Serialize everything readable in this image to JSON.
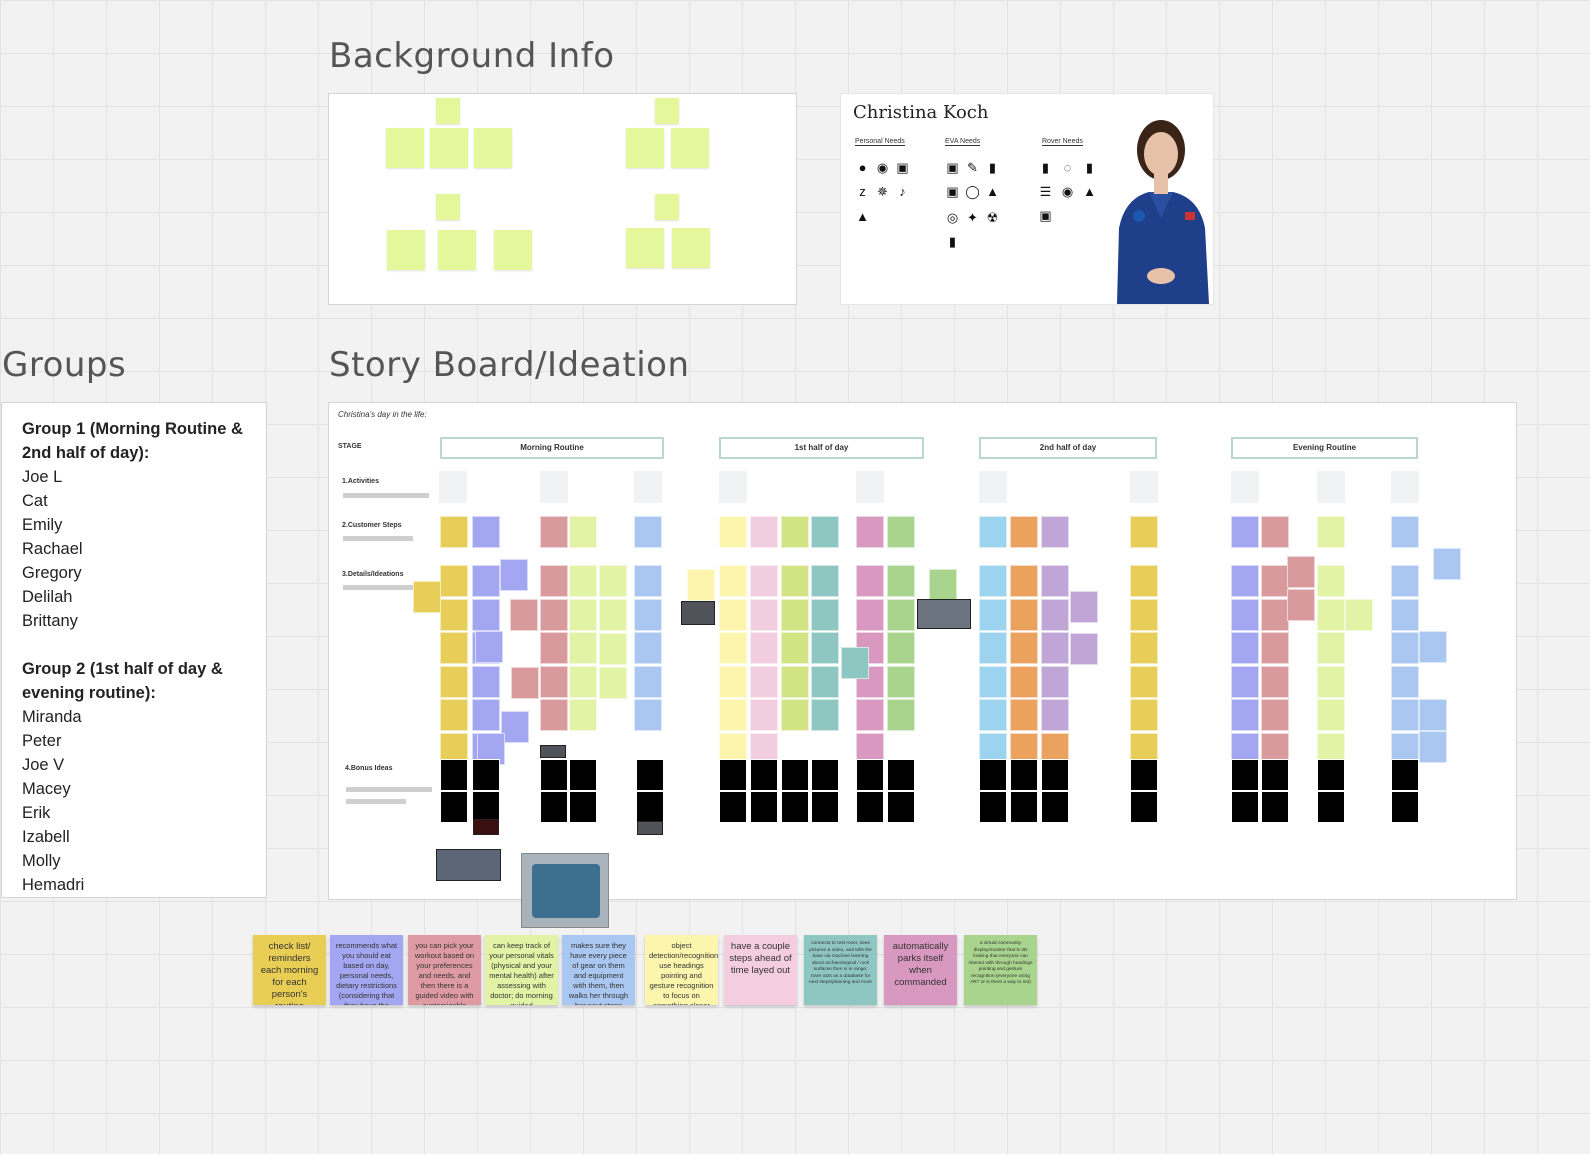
{
  "titles": {
    "background": "Background Info",
    "groups": "Groups",
    "storyboard": "Story Board/Ideation"
  },
  "persona": {
    "name": "Christina Koch",
    "col1": "Personal Needs",
    "col2": "EVA Needs",
    "col3": "Rover Needs"
  },
  "groups": [
    {
      "title": "Group 1 (Morning Routine & 2nd half of day):",
      "members": [
        "Joe L",
        "Cat",
        "Emily",
        "Rachael",
        "Gregory",
        "Delilah",
        "Brittany"
      ]
    },
    {
      "title": "Group 2 (1st half of day & evening routine):",
      "members": [
        "Miranda",
        "Peter",
        "Joe V",
        "Macey",
        "Erik",
        "Izabell",
        "Molly",
        "Hemadri"
      ]
    }
  ],
  "storyboard": {
    "subtitle": "Christina's day in the life:",
    "stage_label": "STAGE",
    "rows": [
      "1.Activities",
      "2.Customer Steps",
      "3.Details/Ideations",
      "4.Bonus Ideas"
    ],
    "stages": [
      "Morning Routine",
      "1st half of day",
      "2nd half of day",
      "Evening Routine"
    ]
  },
  "colors": {
    "yellow": "#e7ce59",
    "periwinkle": "#a3a6f0",
    "rose": "#d99a9e",
    "lime": "#e2f3a6",
    "blue": "#a9c7f0",
    "cream": "#fbf5ad",
    "pink": "#f2cde0",
    "olive": "#d1e382",
    "teal": "#8ec7c2",
    "magenta": "#d898c0",
    "green": "#a9d48d",
    "sky": "#9cd4f0",
    "orange": "#eba25f",
    "lavender": "#bfa6d6",
    "sticky_green": "#e4f79a"
  },
  "notes": [
    {
      "text": "check list/ reminders each morning for each person's routine",
      "color": "#e9ce55"
    },
    {
      "text": "recommends what you should eat based on day, personal needs, dietary restrictions (considering that they have the option), while eating you get an overview of day",
      "color": "#a3a6f0"
    },
    {
      "text": "you can pick your workout based on your preferences and needs, and then there is a guided video with customizable levels/product/whatever they want",
      "color": "#df9ba3"
    },
    {
      "text": "can keep track of your personal vitals (physical and your mental health) after assessing with doctor; do morning guided meditation??",
      "color": "#e2f3a6"
    },
    {
      "text": "makes sure they have every piece of gear on them and equipment with them, then walks her through her next steps",
      "color": "#a9c7f0"
    },
    {
      "text": "object detection/recognition: use headings pointing and gesture recognition to focus on something closer and have the option to just save it to data base or send to someone specific",
      "color": "#fbf5ad"
    },
    {
      "text": "have a couple steps ahead of time layed out",
      "color": "#f4cde0"
    },
    {
      "text": "connects to rest rover, sees pictures & video, and tells the base via machine learning about archaeological / rock surfaces then is in range; rover acts as a database for next steps/planning and more",
      "color": "#8ec7c2"
    },
    {
      "text": "automatically parks itself when commanded",
      "color": "#d898c0"
    },
    {
      "text": "a virtual community display/monitor that is 3D looking that everyone can interact with through headings pointing and gesture recognition (everyone using AR? or is there a way to not)",
      "color": "#a9d48d"
    }
  ]
}
